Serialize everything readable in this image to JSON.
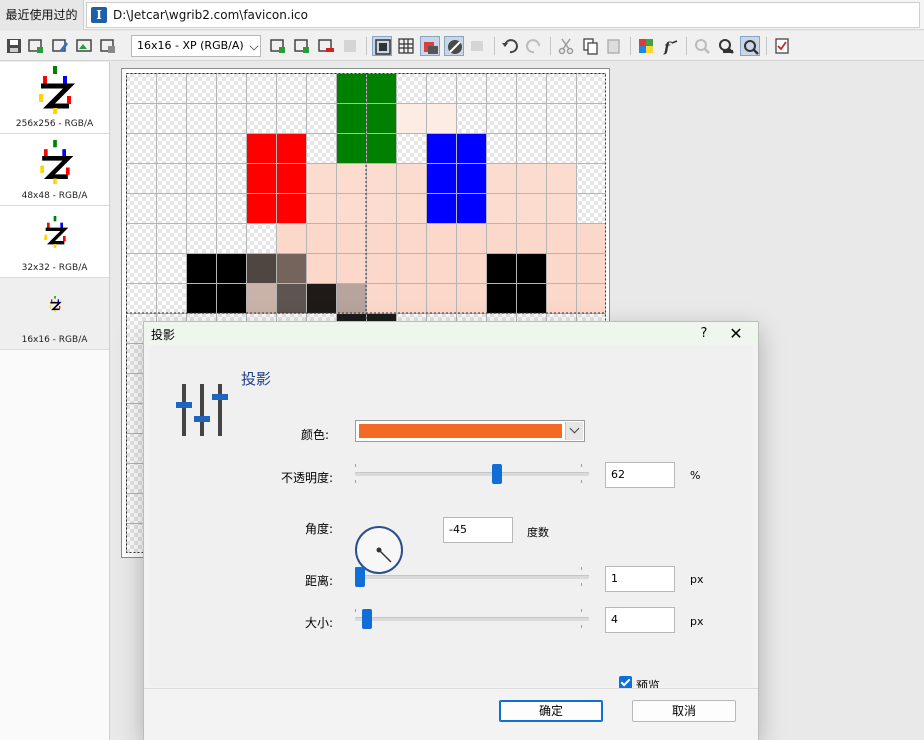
{
  "topbar": {
    "recent_label": "最近使用过的",
    "file_path": "D:\\Jetcar\\wgrib2.com\\favicon.ico"
  },
  "toolbar": {
    "format_selected": "16x16 - XP (RGB/A)",
    "icons": [
      "save-icon",
      "new-image-icon",
      "edit-icon",
      "import-image-icon",
      "export-image-icon",
      "add-format-icon",
      "add-format2-icon",
      "delete-format-icon",
      "disabled-icon",
      "view-single-icon",
      "grid-icon",
      "fill-icon",
      "brush-icon",
      "disabled-icon2",
      "undo-icon",
      "redo-icon",
      "cut-icon",
      "copy-icon",
      "paste-icon",
      "color-palette-icon",
      "fx-icon",
      "zoom-disabled-icon",
      "zoom-out-icon",
      "zoom-in-icon",
      "checklist-icon"
    ]
  },
  "formats": [
    {
      "label": "256x256 - RGB/A",
      "selected": false
    },
    {
      "label": "48x48 - RGB/A",
      "selected": false
    },
    {
      "label": "32x32 - RGB/A",
      "selected": false
    },
    {
      "label": "16x16 - RGB/A",
      "selected": true
    }
  ],
  "dialog": {
    "title": "投影",
    "heading": "投影",
    "help": "?",
    "close": "✕",
    "color_label": "颜色:",
    "color_value": "#F26A24",
    "opacity_label": "不透明度:",
    "opacity_value": "62",
    "opacity_unit": "%",
    "angle_label": "角度:",
    "angle_value": "-45",
    "angle_unit": "度数",
    "distance_label": "距离:",
    "distance_value": "1",
    "distance_unit": "px",
    "size_label": "大小:",
    "size_value": "4",
    "size_unit": "px",
    "preview_label": "预览",
    "preview_checked": true,
    "ok_label": "确定",
    "cancel_label": "取消"
  },
  "colors": {
    "accent": "#0F6FD6",
    "red": "#FF0000",
    "green": "#008000",
    "blue": "#0000FF",
    "shadow": "#FCDDD0"
  }
}
